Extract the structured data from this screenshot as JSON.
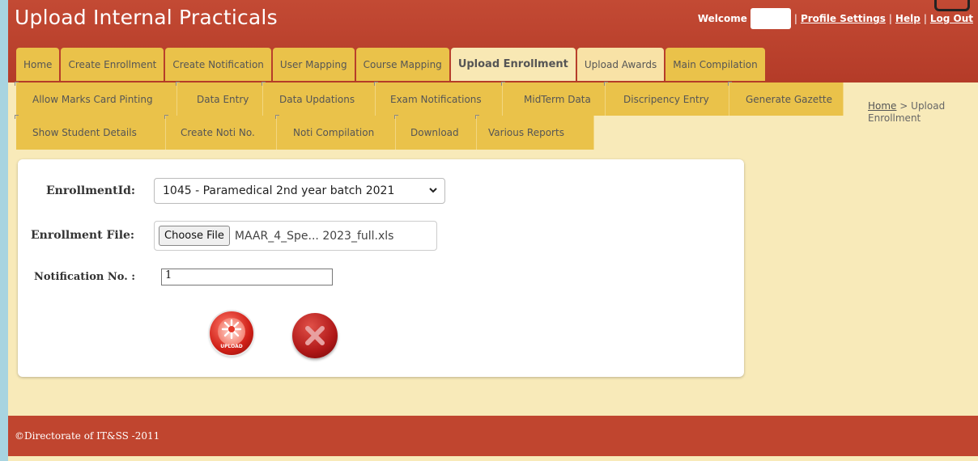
{
  "header": {
    "title": "Upload Internal Practicals",
    "welcome_label": "Welcome",
    "links": [
      "Profile Settings",
      "Help",
      "Log Out"
    ]
  },
  "tabs": [
    {
      "label": "Home",
      "state": "normal"
    },
    {
      "label": "Create Enrollment",
      "state": "normal"
    },
    {
      "label": "Create Notification",
      "state": "normal"
    },
    {
      "label": "User Mapping",
      "state": "normal"
    },
    {
      "label": "Course Mapping",
      "state": "normal"
    },
    {
      "label": "Upload Enrollment",
      "state": "active"
    },
    {
      "label": "Upload Awards",
      "state": "light"
    },
    {
      "label": "Main Compilation",
      "state": "normal"
    }
  ],
  "submenu_row1": [
    "Allow Marks Card Pinting",
    "Data Entry",
    "Data Updations",
    "Exam Notifications",
    "MidTerm Data",
    "Discripency Entry",
    "Generate Gazette"
  ],
  "submenu_row2": [
    "Show Student Details",
    "Create Noti No.",
    "Noti Compilation",
    "Download",
    "Various Reports"
  ],
  "breadcrumb": {
    "home": "Home",
    "separator": ">",
    "current": "Upload Enrollment"
  },
  "form": {
    "enrollment_id_label": "EnrollmentId:",
    "enrollment_id_value": "1045 - Paramedical 2nd year batch 2021",
    "enrollment_file_label": "Enrollment File:",
    "choose_file_label": "Choose File",
    "file_name": "MAAR_4_Spe... 2023_full.xls",
    "notification_label": "Notification No. :",
    "notification_value": "1",
    "upload_button_text": "UPLOAD"
  },
  "footer": {
    "text": "©Directorate of IT&SS -2011"
  },
  "colors": {
    "header_bg": "#b43b28",
    "tab_bg": "#eac24a",
    "page_bg": "#f8eab9"
  }
}
